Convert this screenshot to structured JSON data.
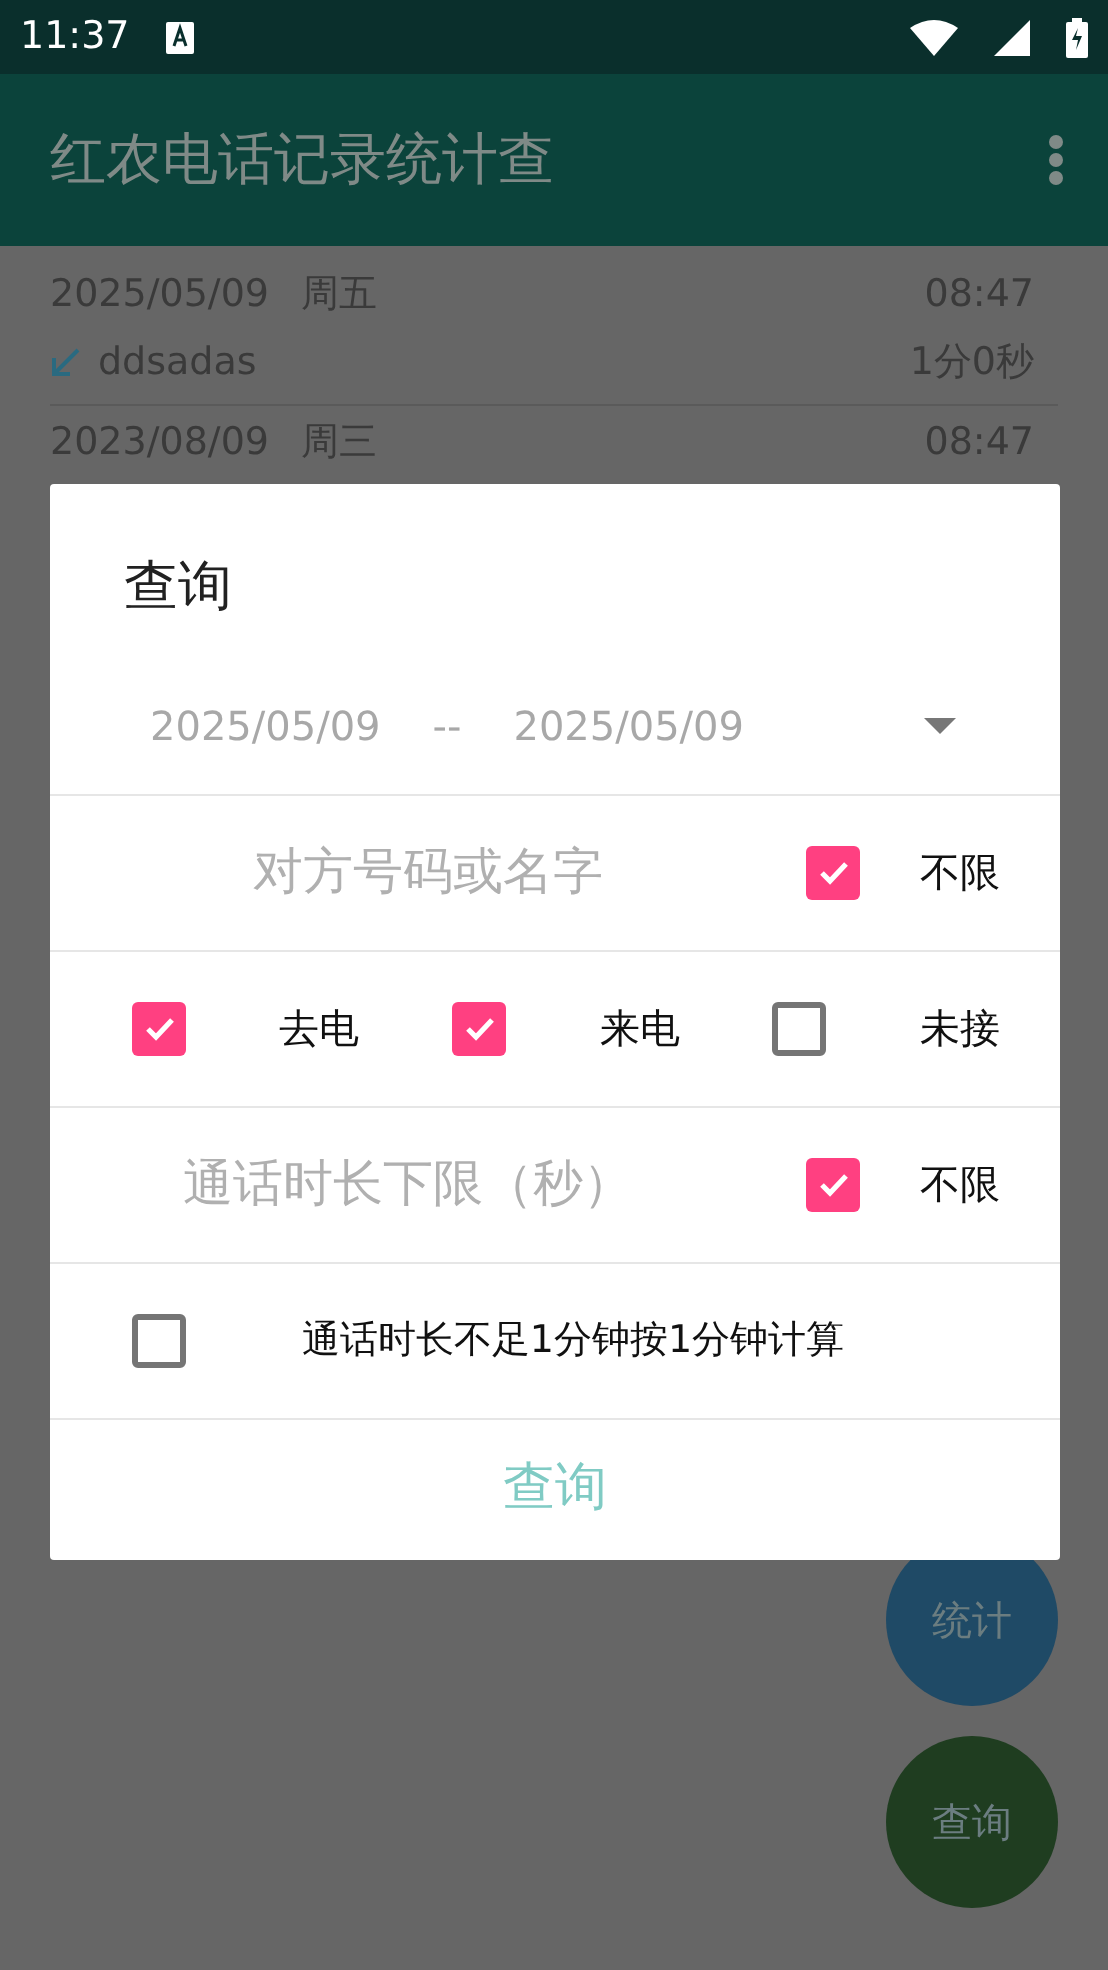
{
  "status_bar": {
    "time": "11:37"
  },
  "app_bar": {
    "title": "红农电话记录统计查"
  },
  "records": [
    {
      "date": "2025/05/09",
      "weekday": "周五",
      "time": "08:47",
      "name": "ddsadas",
      "duration": "1分0秒"
    },
    {
      "date": "2023/08/09",
      "weekday": "周三",
      "time": "08:47"
    }
  ],
  "fabs": [
    {
      "label": "统计",
      "color": "#1f4a66"
    },
    {
      "label": "查询",
      "color": "#1f3d20"
    }
  ],
  "dialog": {
    "title": "查询",
    "date_from": "2025/05/09",
    "date_separator": "--",
    "date_to": "2025/05/09",
    "contact": {
      "placeholder": "对方号码或名字",
      "unlimited": {
        "label": "不限",
        "checked": true
      }
    },
    "call_types": [
      {
        "label": "去电",
        "checked": true
      },
      {
        "label": "来电",
        "checked": true
      },
      {
        "label": "未接",
        "checked": false
      }
    ],
    "min_duration": {
      "placeholder": "通话时长下限（秒）",
      "unlimited": {
        "label": "不限",
        "checked": true
      }
    },
    "round_up": {
      "label": "通话时长不足1分钟按1分钟计算",
      "checked": false
    },
    "submit": "查询"
  }
}
